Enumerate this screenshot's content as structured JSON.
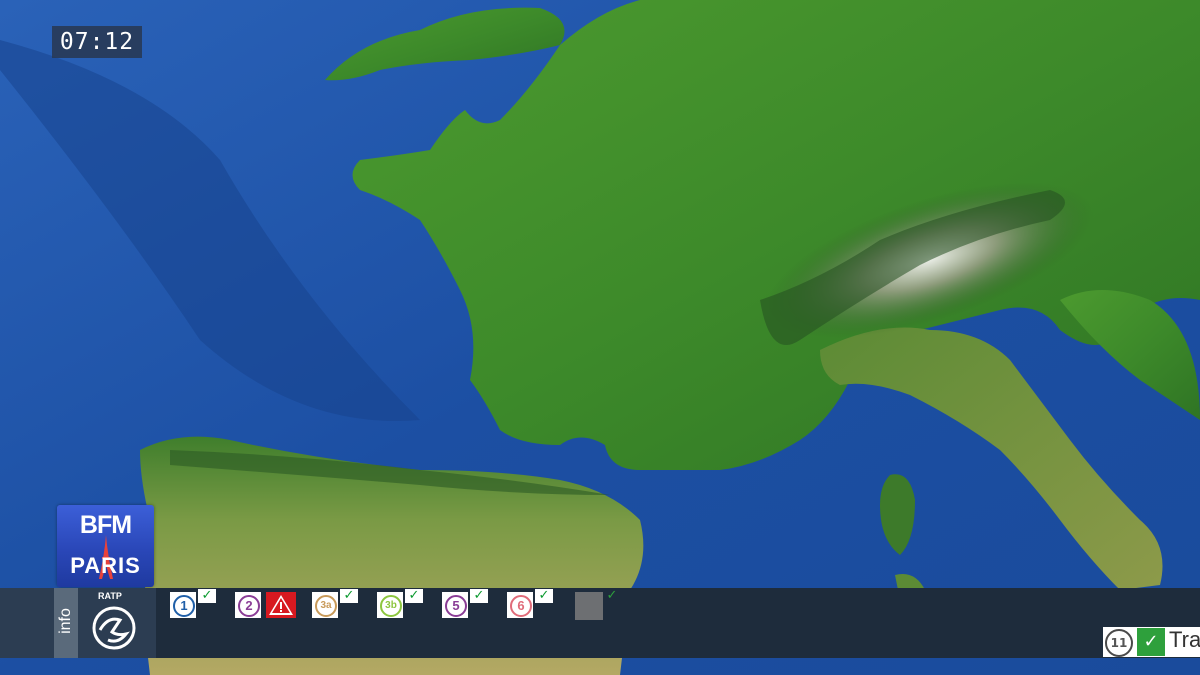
{
  "clock": {
    "time": "07:12"
  },
  "logo": {
    "line1": "BFM",
    "line2": "PARIS"
  },
  "ticker": {
    "info_label": "info",
    "operator": "RATP",
    "lines": [
      {
        "number": "1",
        "color": "#1f5fa8",
        "status": "ok"
      },
      {
        "number": "2",
        "color": "#8a3d96",
        "status": "alert"
      },
      {
        "number": "3a",
        "color": "#c89a5a",
        "status": "ok"
      },
      {
        "number": "3b",
        "color": "#8dc63f",
        "status": "ok"
      },
      {
        "number": "5",
        "color": "#8a3d96",
        "status": "ok"
      },
      {
        "number": "6",
        "color": "#e06c7a",
        "status": "ok"
      },
      {
        "number": "",
        "color": "#6d6f72",
        "status": "ok"
      }
    ],
    "rer": {
      "number": "11",
      "status": "ok",
      "text": "Tra"
    }
  },
  "icons": {
    "check": "check-icon",
    "alert": "warning-triangle-icon",
    "ratp": "ratp-logo-icon",
    "tower": "eiffel-tower-icon"
  }
}
